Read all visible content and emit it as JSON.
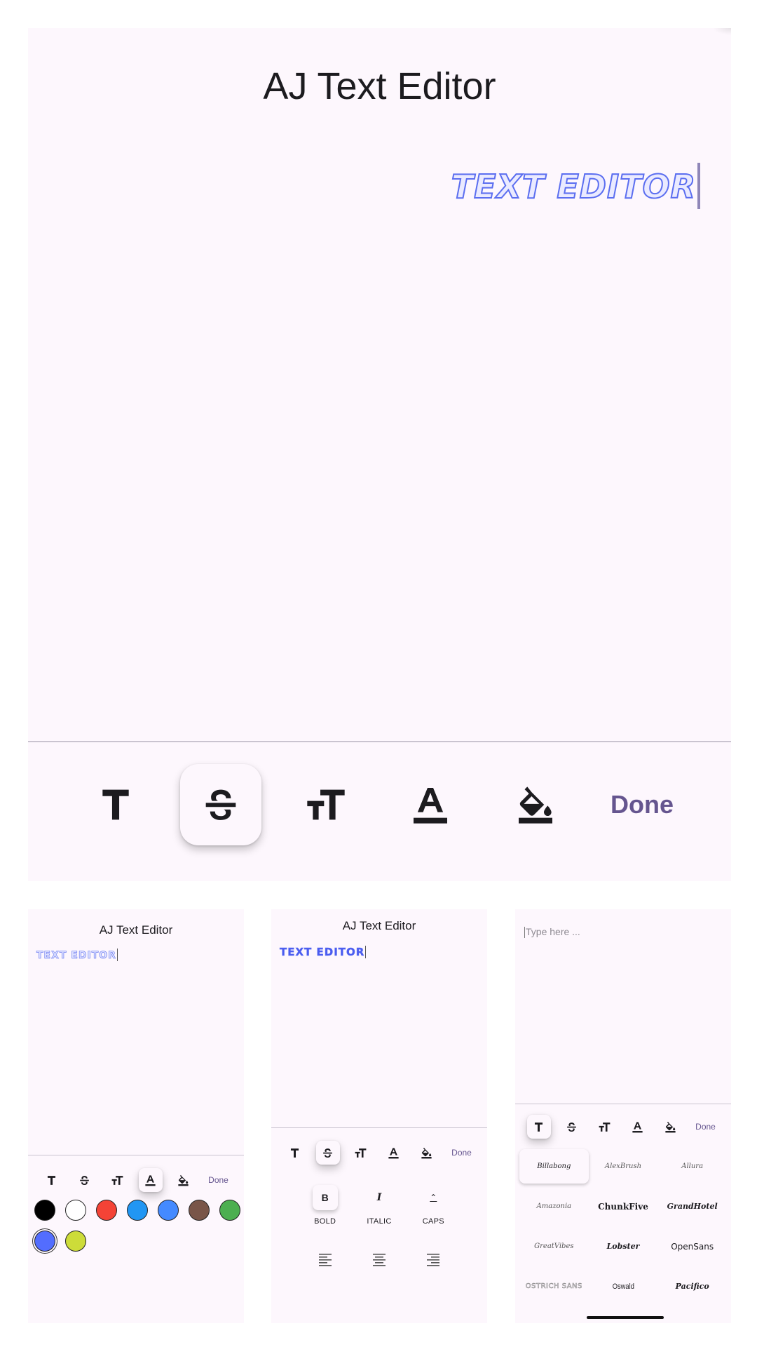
{
  "app": {
    "title": "AJ Text Editor"
  },
  "main": {
    "canvas_text": "TEXT EDITOR",
    "active_tool": "strikethrough",
    "done_label": "Done"
  },
  "toolbar": {
    "tools": [
      {
        "icon": "text-icon"
      },
      {
        "icon": "strikethrough-icon"
      },
      {
        "icon": "text-size-icon"
      },
      {
        "icon": "font-color-icon"
      },
      {
        "icon": "fill-color-icon"
      }
    ],
    "done_label": "Done"
  },
  "color_panel": {
    "title": "AJ Text Editor",
    "canvas_text": "TEXT EDITOR",
    "done_label": "Done",
    "colors": [
      "#000000",
      "#ffffff",
      "#f44336",
      "#2196f3",
      "#448aff",
      "#795548",
      "#4caf50",
      "#536dfe",
      "#cddc39"
    ],
    "selected_color": "#536dfe"
  },
  "style_panel": {
    "title": "AJ Text Editor",
    "canvas_text": "TEXT EDITOR",
    "done_label": "Done",
    "styles": [
      {
        "glyph": "B",
        "label": "BOLD"
      },
      {
        "glyph": "I",
        "label": "ITALIC"
      },
      {
        "glyph": "⌃",
        "label": "CAPS"
      }
    ]
  },
  "font_panel": {
    "placeholder": "Type here ...",
    "done_label": "Done",
    "fonts": [
      "Billabong",
      "AlexBrush",
      "Allura",
      "Amazonia",
      "ChunkFive",
      "GrandHotel",
      "GreatVibes",
      "Lobster",
      "OpenSans",
      "OSTRICH SANS",
      "Oswald",
      "Pacifico"
    ],
    "selected_font": "Billabong"
  }
}
